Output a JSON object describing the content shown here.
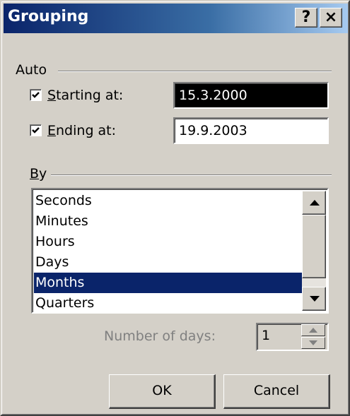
{
  "window": {
    "title": "Grouping",
    "help_button": "?",
    "close_button": "×"
  },
  "auto_group": {
    "label": "Auto",
    "starting": {
      "checked": true,
      "label_mnemonic": "S",
      "label_rest": "tarting at:",
      "value": "15.3.2000"
    },
    "ending": {
      "checked": true,
      "label_mnemonic": "E",
      "label_rest": "nding at:",
      "value": "19.9.2003"
    }
  },
  "by_group": {
    "label_mnemonic": "B",
    "label_rest": "y",
    "items": [
      {
        "label": "Seconds",
        "selected": false
      },
      {
        "label": "Minutes",
        "selected": false
      },
      {
        "label": "Hours",
        "selected": false
      },
      {
        "label": "Days",
        "selected": false
      },
      {
        "label": "Months",
        "selected": true
      },
      {
        "label": "Quarters",
        "selected": false
      }
    ]
  },
  "number_of_days": {
    "label": "Number of days:",
    "value": "1",
    "enabled": false
  },
  "buttons": {
    "ok": "OK",
    "cancel": "Cancel"
  },
  "colors": {
    "face": "#d4d0c8",
    "title_start": "#0a246a",
    "title_end": "#a6caf0",
    "selection": "#0a246a"
  }
}
